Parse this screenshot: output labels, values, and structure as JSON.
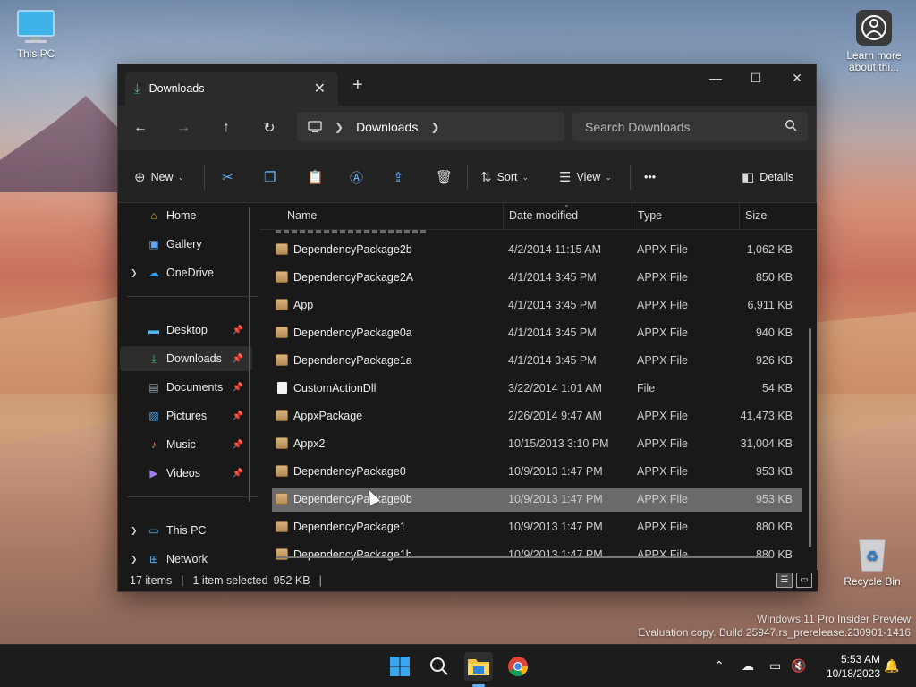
{
  "desktop": {
    "icons": [
      {
        "label": "This PC"
      },
      {
        "label": "Learn more about thi..."
      },
      {
        "label": "Recycle Bin"
      }
    ],
    "watermark_line1": "Windows 11 Pro Insider Preview",
    "watermark_line2": "Evaluation copy. Build 25947.rs_prerelease.230901-1416"
  },
  "window": {
    "tab_title": "Downloads",
    "new_tab": "+",
    "controls": {
      "minimize": "—",
      "maximize": "☐",
      "close": "✕"
    }
  },
  "addressbar": {
    "path": "Downloads",
    "search_placeholder": "Search Downloads"
  },
  "toolbar": {
    "new_label": "New",
    "sort_label": "Sort",
    "view_label": "View",
    "more_label": "•••",
    "details_label": "Details"
  },
  "nav": {
    "items": [
      {
        "label": "Home",
        "icon": "home-icon"
      },
      {
        "label": "Gallery",
        "icon": "gallery-icon"
      },
      {
        "label": "OneDrive",
        "icon": "cloud-icon"
      },
      {
        "label": "Desktop",
        "icon": "desktop-icon"
      },
      {
        "label": "Downloads",
        "icon": "download-icon"
      },
      {
        "label": "Documents",
        "icon": "documents-icon"
      },
      {
        "label": "Pictures",
        "icon": "pictures-icon"
      },
      {
        "label": "Music",
        "icon": "music-icon"
      },
      {
        "label": "Videos",
        "icon": "videos-icon"
      },
      {
        "label": "This PC",
        "icon": "pc-icon"
      },
      {
        "label": "Network",
        "icon": "network-icon"
      }
    ]
  },
  "columns": {
    "name": "Name",
    "date": "Date modified",
    "type": "Type",
    "size": "Size"
  },
  "files": [
    {
      "name": "DependencyPackage2b",
      "date": "4/2/2014 11:15 AM",
      "type": "APPX File",
      "size": "1,062 KB",
      "kind": "package"
    },
    {
      "name": "DependencyPackage2A",
      "date": "4/1/2014 3:45 PM",
      "type": "APPX File",
      "size": "850 KB",
      "kind": "package"
    },
    {
      "name": "App",
      "date": "4/1/2014 3:45 PM",
      "type": "APPX File",
      "size": "6,911 KB",
      "kind": "package"
    },
    {
      "name": "DependencyPackage0a",
      "date": "4/1/2014 3:45 PM",
      "type": "APPX File",
      "size": "940 KB",
      "kind": "package"
    },
    {
      "name": "DependencyPackage1a",
      "date": "4/1/2014 3:45 PM",
      "type": "APPX File",
      "size": "926 KB",
      "kind": "package"
    },
    {
      "name": "CustomActionDll",
      "date": "3/22/2014 1:01 AM",
      "type": "File",
      "size": "54 KB",
      "kind": "file"
    },
    {
      "name": "AppxPackage",
      "date": "2/26/2014 9:47 AM",
      "type": "APPX File",
      "size": "41,473 KB",
      "kind": "package"
    },
    {
      "name": "Appx2",
      "date": "10/15/2013 3:10 PM",
      "type": "APPX File",
      "size": "31,004 KB",
      "kind": "package"
    },
    {
      "name": "DependencyPackage0",
      "date": "10/9/2013 1:47 PM",
      "type": "APPX File",
      "size": "953 KB",
      "kind": "package"
    },
    {
      "name": "DependencyPackage0b",
      "date": "10/9/2013 1:47 PM",
      "type": "APPX File",
      "size": "953 KB",
      "kind": "package",
      "selected": true
    },
    {
      "name": "DependencyPackage1",
      "date": "10/9/2013 1:47 PM",
      "type": "APPX File",
      "size": "880 KB",
      "kind": "package"
    },
    {
      "name": "DependencyPackage1b",
      "date": "10/9/2013 1:47 PM",
      "type": "APPX File",
      "size": "880 KB",
      "kind": "package"
    }
  ],
  "status": {
    "count": "17 items",
    "selection": "1 item selected",
    "selection_size": "952 KB"
  },
  "taskbar": {
    "time": "5:53 AM",
    "date": "10/18/2023"
  }
}
